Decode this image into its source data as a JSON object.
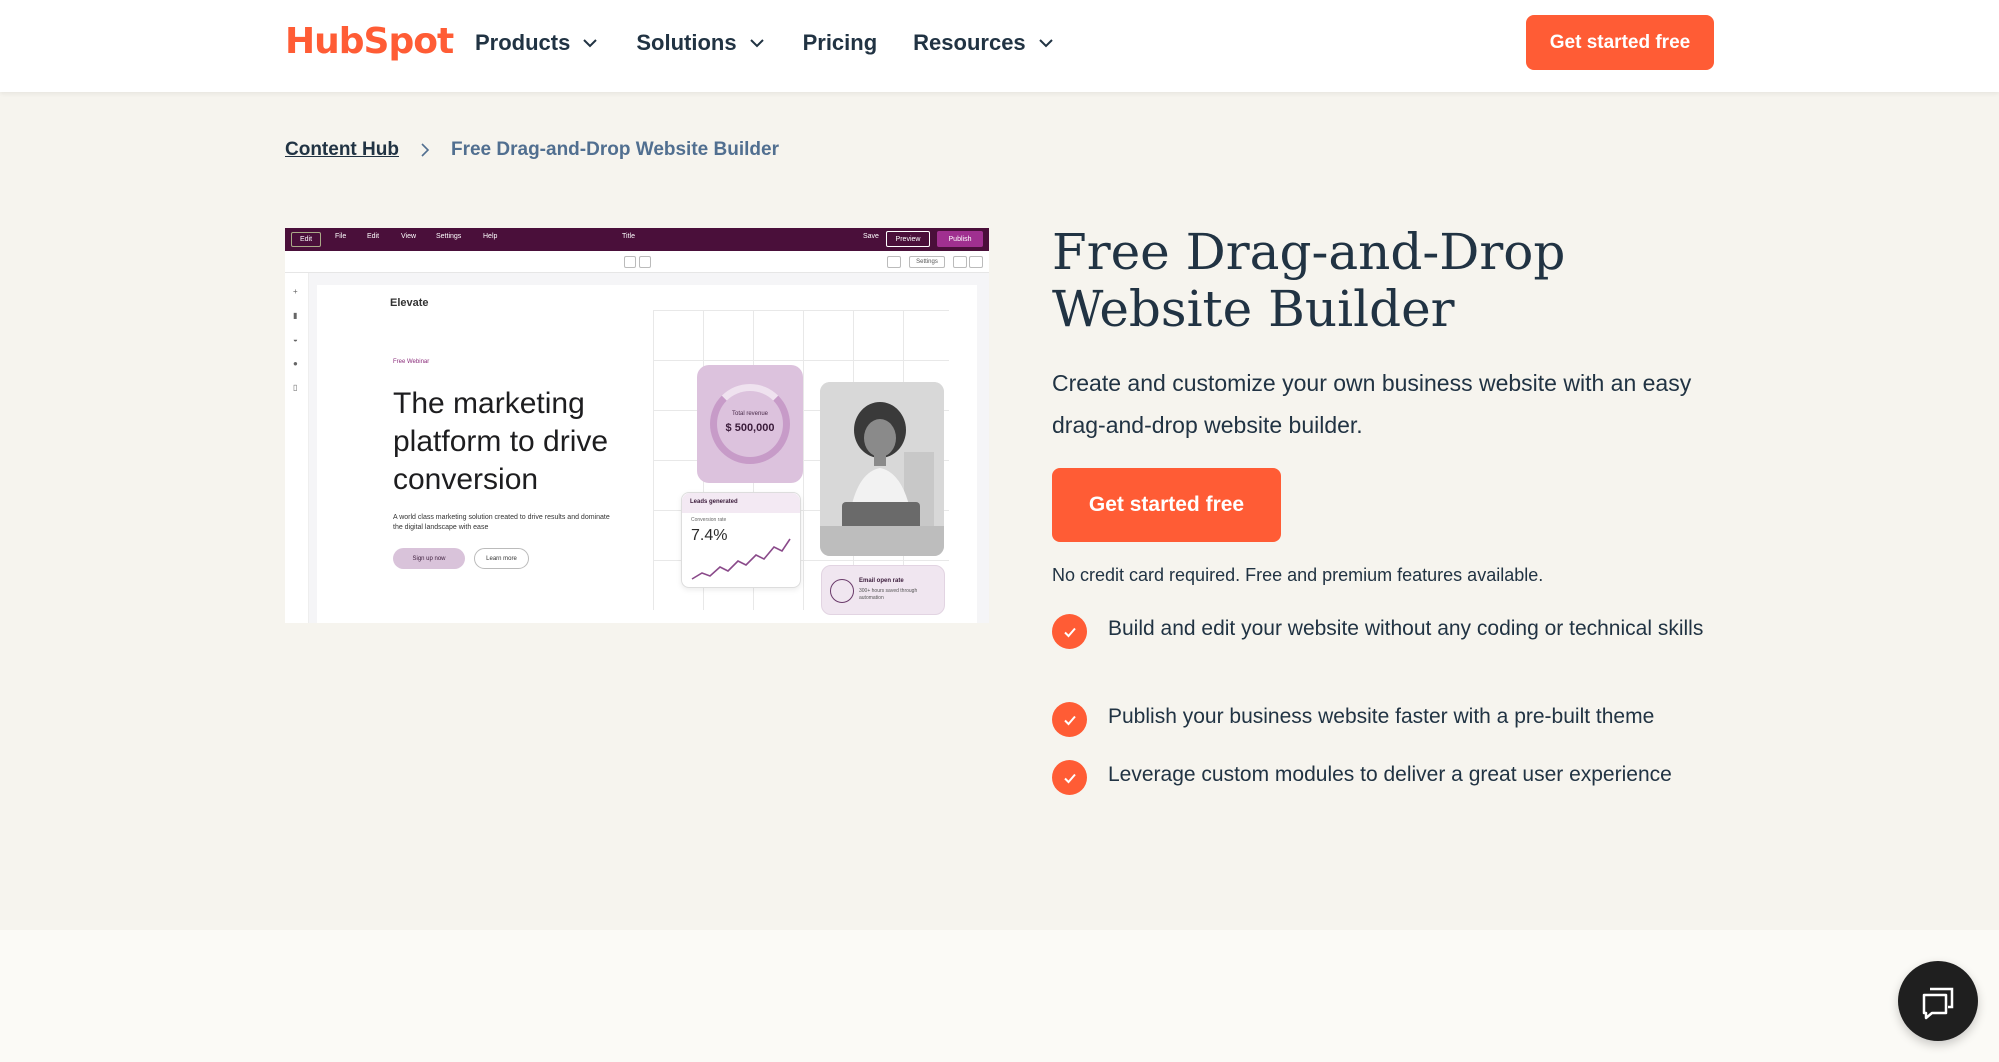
{
  "header": {
    "logo": "HubSpot",
    "nav": [
      {
        "label": "Products",
        "has_menu": true
      },
      {
        "label": "Solutions",
        "has_menu": true
      },
      {
        "label": "Pricing",
        "has_menu": false
      },
      {
        "label": "Resources",
        "has_menu": true
      }
    ],
    "cta_label": "Get started free"
  },
  "breadcrumb": {
    "parent": "Content Hub",
    "current": "Free Drag-and-Drop Website Builder"
  },
  "mock": {
    "menu": [
      "Edit",
      "File",
      "Edit",
      "View",
      "Settings",
      "Help"
    ],
    "doc_title": "Title",
    "save": "Save",
    "preview": "Preview",
    "publish": "Publish",
    "settings": "Settings",
    "brand": "Elevate",
    "eyebrow": "Free Webinar",
    "headline": "The marketing platform to drive conversion",
    "subtext": "A world class marketing solution created to drive results and dominate the digital landscape with ease",
    "primary": "Sign up now",
    "secondary": "Learn more",
    "revenue_label": "Total revenue",
    "revenue_value": "$ 500,000",
    "leads_label": "Leads generated",
    "conversion_label": "Conversion rate",
    "conversion_value": "7.4%",
    "email_label": "Email open rate",
    "email_sub": "300+ hours saved through automation"
  },
  "hero": {
    "title": "Free Drag-and-Drop Website Builder",
    "description": "Create and customize your own business website with an easy drag-and-drop website builder.",
    "cta_label": "Get started free",
    "note": "No credit card required. Free and premium features available.",
    "features": [
      "Build and edit your website without any coding or technical skills",
      "Publish your business website faster with a pre-built theme",
      "Leverage custom modules to deliver a great user experience"
    ]
  },
  "colors": {
    "accent": "#ff5c35",
    "text": "#213343",
    "background": "#f6f4ee",
    "mock_bar": "#4a0f3a"
  },
  "icons": [
    "chevron-down-icon",
    "chevron-right-icon",
    "check-icon",
    "chat-icon"
  ]
}
